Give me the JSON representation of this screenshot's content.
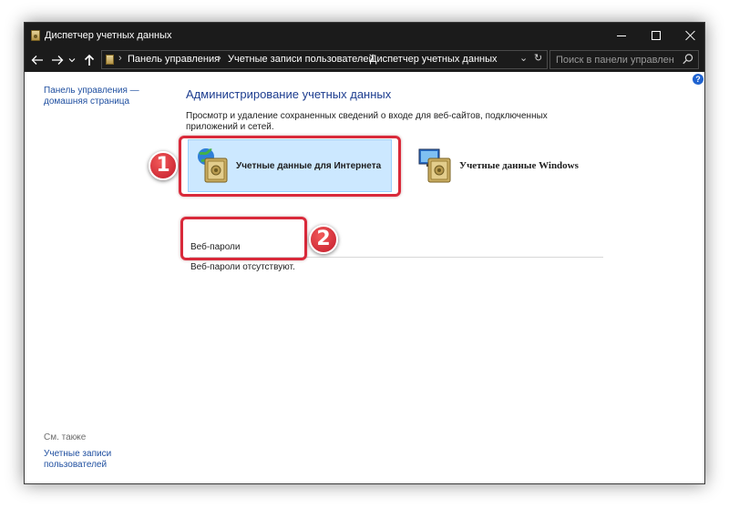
{
  "window": {
    "title": "Диспетчер учетных данных"
  },
  "address": {
    "breadcrumb": [
      "Панель управления",
      "Учетные записи пользователей",
      "Диспетчер учетных данных"
    ],
    "search_placeholder": "Поиск в панели управления"
  },
  "sidebar": {
    "home_link": "Панель управления — домашняя страница",
    "see_also": "См. также",
    "users_link": "Учетные записи пользователей"
  },
  "main": {
    "title": "Администрирование учетных данных",
    "description": "Просмотр и удаление сохраненных сведений о входе для веб-сайтов, подключенных приложений и сетей.",
    "tiles": [
      {
        "label": "Учетные данные для Интернета",
        "selected": true,
        "icon": "web-credentials-icon"
      },
      {
        "label": "Учетные данные Windows",
        "selected": false,
        "icon": "windows-credentials-icon"
      }
    ],
    "section_heading": "Веб-пароли",
    "empty_message": "Веб-пароли отсутствуют."
  },
  "annotations": [
    {
      "number": "1"
    },
    {
      "number": "2"
    }
  ],
  "colors": {
    "titlebar": "#1b1b1b",
    "selected_tile": "#cce8ff",
    "heading_blue": "#1d3d8f",
    "link_blue": "#1f4fa0",
    "callout_red": "#d9293a"
  }
}
